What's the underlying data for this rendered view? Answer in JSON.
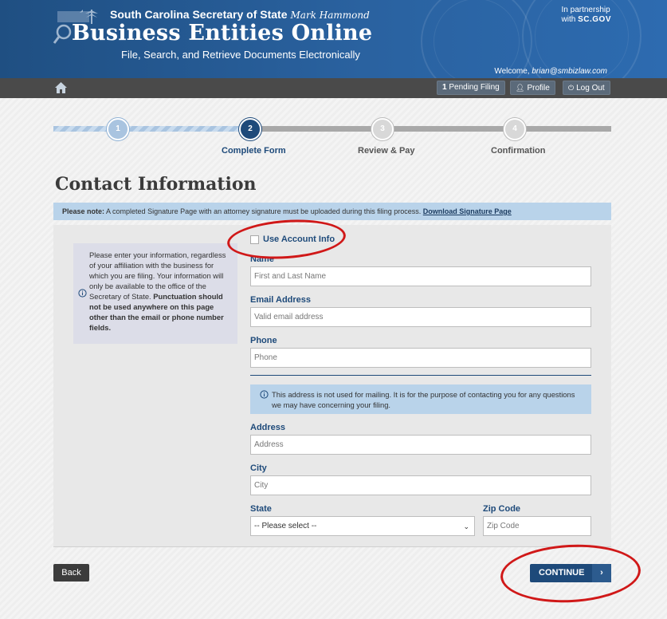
{
  "header": {
    "line1": "South Carolina Secretary of State",
    "signature": "Mark Hammond",
    "title": "Business Entities Online",
    "subtitle": "File, Search, and Retrieve Documents Electronically",
    "partner_line1": "In partnership",
    "partner_line2": "with",
    "partner_brand": "SC.GOV",
    "welcome_prefix": "Welcome, ",
    "welcome_email": "brian@smbizlaw.com"
  },
  "nav": {
    "pending_count": "1",
    "pending_label": "Pending Filing",
    "profile_label": "Profile",
    "logout_label": "Log Out",
    "home_icon": "home-icon",
    "profile_icon": "user-icon",
    "logout_icon": "power-icon"
  },
  "stepper": {
    "steps": [
      {
        "number": "1",
        "label": ""
      },
      {
        "number": "2",
        "label": "Complete Form"
      },
      {
        "number": "3",
        "label": "Review & Pay"
      },
      {
        "number": "4",
        "label": "Confirmation"
      }
    ],
    "active_step": 2
  },
  "page": {
    "title": "Contact Information"
  },
  "note": {
    "prefix": "Please note:",
    "text": " A completed Signature Page with an attorney signature must be uploaded during this filing process. ",
    "link": "Download Signature Page"
  },
  "info_box": {
    "text": "Please enter your information, regardless of your affiliation with the business for which you are filing. Your information will only be available to the office of the Secretary of State.",
    "bold_text": "Punctuation should not be used anywhere on this page other than the email or phone number fields."
  },
  "form": {
    "use_account_info_label": "Use Account Info",
    "use_account_info_checked": false,
    "name_label": "Name",
    "name_placeholder": "First and Last Name",
    "name_value": "",
    "email_label": "Email Address",
    "email_placeholder": "Valid email address",
    "email_value": "",
    "phone_label": "Phone",
    "phone_placeholder": "Phone",
    "phone_value": "",
    "address_note": "This address is not used for mailing. It is for the purpose of contacting you for any questions we may have concerning your filing.",
    "address_label": "Address",
    "address_placeholder": "Address",
    "city_label": "City",
    "city_placeholder": "City",
    "state_label": "State",
    "state_selected": "-- Please select --",
    "zip_label": "Zip Code",
    "zip_placeholder": "Zip Code"
  },
  "buttons": {
    "back_label": "Back",
    "continue_label": "CONTINUE",
    "continue_icon": "chevron-right-icon"
  },
  "colors": {
    "brand_blue": "#1e4a7a",
    "header_blue": "#2a62a0",
    "note_blue": "#b9d3ea",
    "annotation_red": "#d01818"
  }
}
